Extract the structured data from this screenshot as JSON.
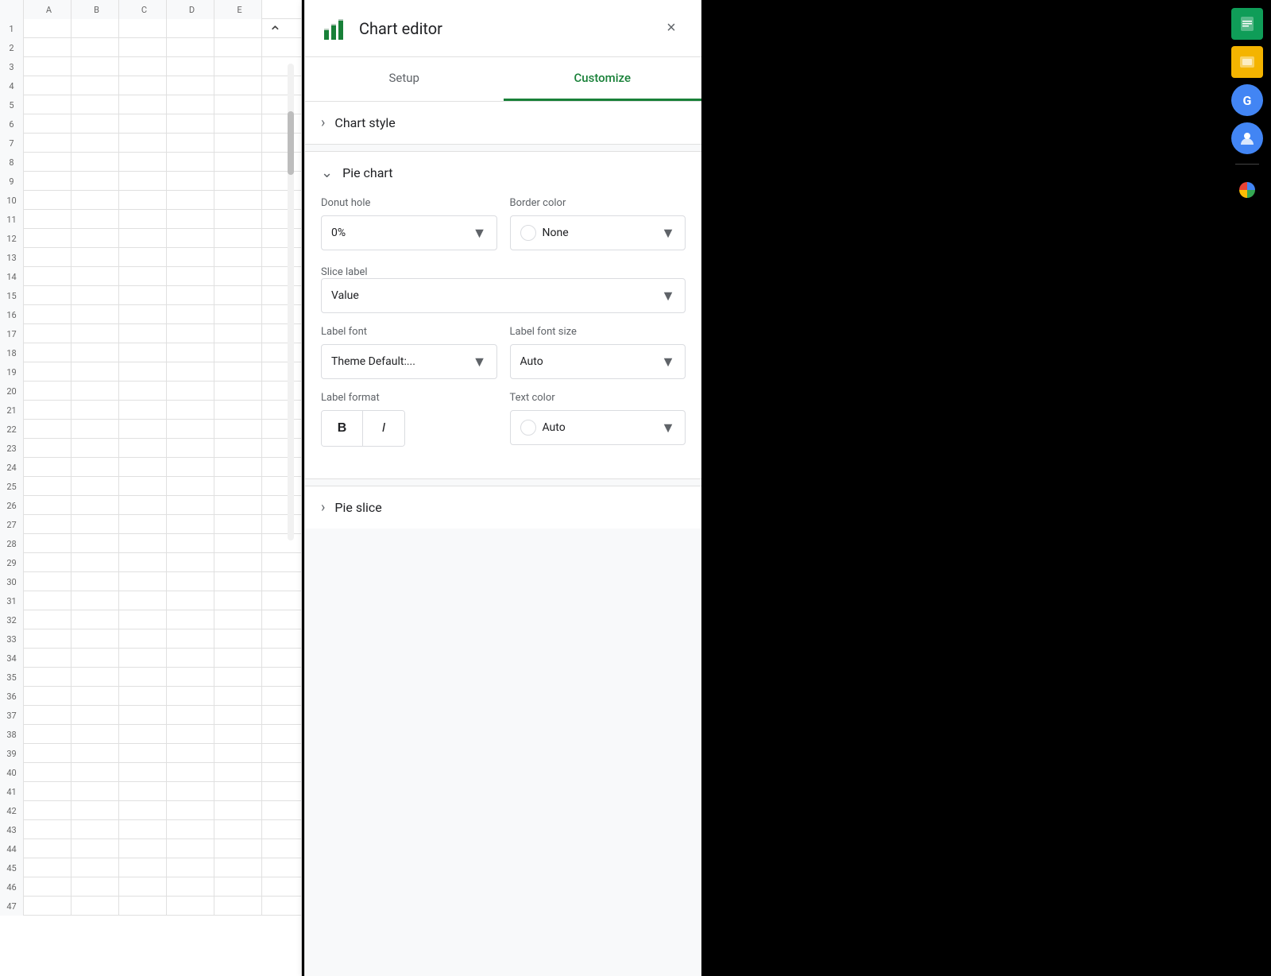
{
  "header": {
    "title": "Chart editor",
    "close_label": "×"
  },
  "tabs": [
    {
      "id": "setup",
      "label": "Setup",
      "active": false
    },
    {
      "id": "customize",
      "label": "Customize",
      "active": true
    }
  ],
  "chart_style_section": {
    "title": "Chart style",
    "chevron": "›"
  },
  "pie_chart_section": {
    "title": "Pie chart",
    "chevron": "∨",
    "donut_hole": {
      "label": "Donut hole",
      "value": "0%"
    },
    "border_color": {
      "label": "Border color",
      "value": "None"
    },
    "slice_label": {
      "label": "Slice label",
      "value": "Value"
    },
    "label_font": {
      "label": "Label font",
      "value": "Theme Default:..."
    },
    "label_font_size": {
      "label": "Label font size",
      "value": "Auto"
    },
    "label_format": {
      "label": "Label format",
      "bold": "B",
      "italic": "I"
    },
    "text_color": {
      "label": "Text color",
      "value": "Auto"
    }
  },
  "pie_slice_section": {
    "title": "Pie slice",
    "chevron": "›"
  },
  "colors": {
    "green_accent": "#188038",
    "blue_accent": "#1a73e8"
  }
}
